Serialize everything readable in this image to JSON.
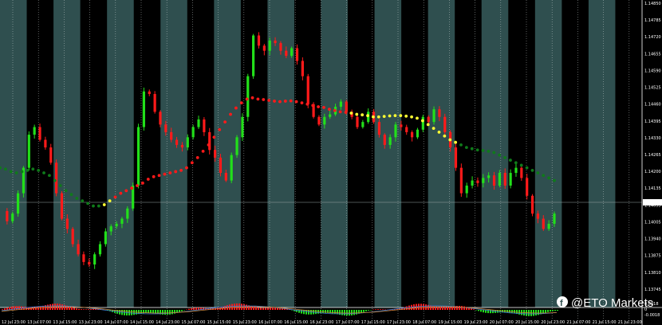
{
  "chart_data": {
    "type": "candlestick",
    "price_axis": {
      "labels": [
        "1.14850",
        "1.14785",
        "1.14720",
        "1.14655",
        "1.14590",
        "1.14525",
        "1.14460",
        "1.14395",
        "1.14330",
        "1.14265",
        "1.14200",
        "1.14135",
        "1.14055",
        "1.14005",
        "1.13940",
        "1.13875",
        "1.13810",
        "1.13745"
      ],
      "current_price_label": "1.14055",
      "ylim": [
        1.13745,
        1.1485
      ]
    },
    "time_axis": {
      "labels": [
        "12 Jul 23:00",
        "13 Jul 07:00",
        "13 Jul 15:00",
        "13 Jul 23:00",
        "14 Jul 07:00",
        "14 Jul 15:00",
        "14 Jul 23:00",
        "15 Jul 07:00",
        "15 Jul 15:00",
        "15 Jul 23:00",
        "16 Jul 07:00",
        "16 Jul 15:00",
        "16 Jul 23:00",
        "17 Jul 07:00",
        "17 Jul 15:00",
        "17 Jul 23:00",
        "18 Jul 07:00",
        "19 Jul 15:00",
        "19 Jul 23:00",
        "20 Jul 07:00",
        "20 Jul 15:00",
        "20 Jul 23:00",
        "21 Jul 07:00",
        "21 Jul 15:00",
        "21 Jul 23:00"
      ]
    },
    "indicator_axis": {
      "labels": [
        "0.0018",
        "0",
        "-0.0018"
      ]
    },
    "colors": {
      "bull": "#22e01a",
      "bear": "#ff1a1a",
      "band_dark": "#000000",
      "band_light": "#2f4f4f",
      "ma_green": "#0f7a1a",
      "ma_red": "#ff1a1a",
      "ma_yellow": "#ffff33"
    },
    "session_bands": [
      {
        "from": 0,
        "to": 1
      },
      {
        "from": 1,
        "to": 2
      },
      {
        "from": 2,
        "to": 3
      },
      {
        "from": 3,
        "to": 4
      },
      {
        "from": 4,
        "to": 5
      },
      {
        "from": 5,
        "to": 6
      },
      {
        "from": 6,
        "to": 7
      },
      {
        "from": 7,
        "to": 8
      },
      {
        "from": 8,
        "to": 9
      },
      {
        "from": 9,
        "to": 10
      },
      {
        "from": 10,
        "to": 11
      },
      {
        "from": 11,
        "to": 12
      },
      {
        "from": 12,
        "to": 13
      },
      {
        "from": 13,
        "to": 14
      },
      {
        "from": 14,
        "to": 15
      },
      {
        "from": 15,
        "to": 16
      },
      {
        "from": 16,
        "to": 17
      },
      {
        "from": 17,
        "to": 18
      },
      {
        "from": 18,
        "to": 19
      },
      {
        "from": 19,
        "to": 20
      },
      {
        "from": 20,
        "to": 21
      },
      {
        "from": 21,
        "to": 22
      },
      {
        "from": 22,
        "to": 23
      },
      {
        "from": 23,
        "to": 24
      }
    ],
    "price_path": [
      1.1403,
      1.1399,
      1.1402,
      1.141,
      1.142,
      1.1433,
      1.1436,
      1.1431,
      1.1428,
      1.1422,
      1.141,
      1.14,
      1.1396,
      1.139,
      1.1386,
      1.1383,
      1.1382,
      1.1386,
      1.139,
      1.1395,
      1.1397,
      1.1398,
      1.14,
      1.1404,
      1.1413,
      1.1436,
      1.145,
      1.1449,
      1.1442,
      1.1437,
      1.1434,
      1.1431,
      1.1429,
      1.1428,
      1.1432,
      1.1436,
      1.1439,
      1.1434,
      1.1427,
      1.1424,
      1.1418,
      1.1415,
      1.1425,
      1.1432,
      1.144,
      1.1456,
      1.1472,
      1.1468,
      1.1466,
      1.147,
      1.1469,
      1.1466,
      1.1464,
      1.1467,
      1.1462,
      1.1456,
      1.1445,
      1.144,
      1.1437,
      1.144,
      1.1441,
      1.1444,
      1.1446,
      1.1442,
      1.144,
      1.1436,
      1.1438,
      1.1442,
      1.1438,
      1.1433,
      1.1429,
      1.1432,
      1.1437,
      1.1436,
      1.1434,
      1.1432,
      1.1435,
      1.144,
      1.1438,
      1.1443,
      1.144,
      1.1434,
      1.1428,
      1.142,
      1.141,
      1.1413,
      1.1415,
      1.1414,
      1.1416,
      1.1417,
      1.1413,
      1.1418,
      1.1413,
      1.1418,
      1.142,
      1.1416,
      1.1409,
      1.1402,
      1.14,
      1.1396,
      1.1398,
      1.1402
    ],
    "ma_path": [
      1.142,
      1.14195,
      1.14185,
      1.1418,
      1.14185,
      1.1419,
      1.14195,
      1.1419,
      1.1418,
      1.1417,
      1.1415,
      1.1413,
      1.1411,
      1.14095,
      1.1408,
      1.1407,
      1.1406,
      1.1405,
      1.1405,
      1.14055,
      1.1407,
      1.14085,
      1.141,
      1.1411,
      1.1412,
      1.1413,
      1.1414,
      1.14155,
      1.14165,
      1.1417,
      1.14175,
      1.1418,
      1.14185,
      1.1419,
      1.142,
      1.1422,
      1.1424,
      1.14265,
      1.1429,
      1.1432,
      1.1435,
      1.1438,
      1.1441,
      1.14435,
      1.14455,
      1.1447,
      1.14475,
      1.1447,
      1.14468,
      1.14465,
      1.14462,
      1.1446,
      1.14462,
      1.14463,
      1.1446,
      1.14455,
      1.1445,
      1.14445,
      1.1444,
      1.14437,
      1.1443,
      1.14425,
      1.1442,
      1.14418,
      1.14415,
      1.1441,
      1.14408,
      1.14405,
      1.144,
      1.144,
      1.14402,
      1.14404,
      1.14405,
      1.14405,
      1.14403,
      1.144,
      1.14395,
      1.14385,
      1.1437,
      1.14355,
      1.1434,
      1.14325,
      1.1431,
      1.143,
      1.1429,
      1.1428,
      1.14275,
      1.1427,
      1.14268,
      1.14265,
      1.1426,
      1.1425,
      1.1424,
      1.1423,
      1.1422,
      1.1421,
      1.142,
      1.1419,
      1.1418,
      1.1417,
      1.1416,
      1.1415
    ],
    "ma_colors": "gggggggggggggggggggyyrrrrrrrrrrrrrrrrrrrrrrrrrrrrrrrrrrrrrrrrrrryyyyyyyyyyyyyyyyyyyyggggggggggggggggggggggggg"
  },
  "watermark": {
    "icon": "facebook-icon",
    "text": "@ETO Markets"
  }
}
